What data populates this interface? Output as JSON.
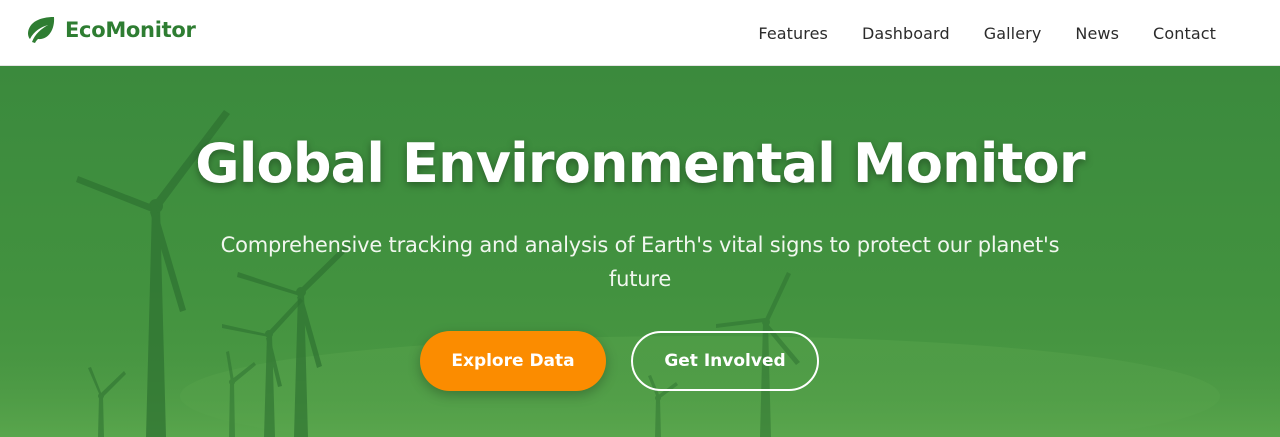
{
  "brand": {
    "name": "EcoMonitor",
    "icon": "leaf-icon",
    "color": "#2e7d32"
  },
  "nav": {
    "items": [
      {
        "label": "Features"
      },
      {
        "label": "Dashboard"
      },
      {
        "label": "Gallery"
      },
      {
        "label": "News"
      },
      {
        "label": "Contact"
      }
    ]
  },
  "hero": {
    "title": "Global Environmental Monitor",
    "subtitle": "Comprehensive tracking and analysis of Earth's vital signs to protect our planet's future",
    "background": "wind-turbines-image",
    "overlay_color": "#3e8f40",
    "primary_button": {
      "label": "Explore Data",
      "color": "#fb8c00"
    },
    "secondary_button": {
      "label": "Get Involved"
    }
  }
}
